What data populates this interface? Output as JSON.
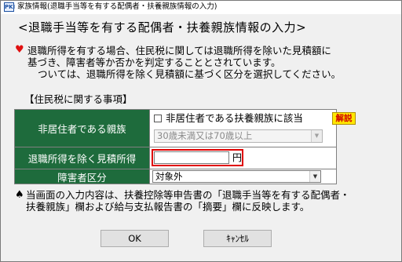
{
  "window": {
    "app_icon": "PKI",
    "title": "家族情報(退職手当等を有する配偶者・扶養親族情報の入力)"
  },
  "heading": "<退職手当等を有する配偶者・扶養親族情報の入力>",
  "description": {
    "bullet_icon": "heart-icon",
    "line1": "退職所得を有する場合、住民税に関しては退職所得を除いた見積額に",
    "line2": "基づき、障害者等か否かを判定することとされています。",
    "line3": "ついては、退職所得を除く見積額に基づく区分を選択してください。"
  },
  "section_label": "【住民税に関する事項】",
  "form": {
    "non_resident": {
      "label": "非居住者である親族",
      "checkbox_label": "非居住者である扶養親族に該当",
      "checked": false,
      "help_button": "解説",
      "age_select_value": "30歳未満又は70歳以上"
    },
    "estimate": {
      "label": "退職所得を除く見積所得",
      "value": "",
      "unit": "円"
    },
    "disability": {
      "label": "障害者区分",
      "selected": "対象外"
    }
  },
  "note": {
    "bullet_icon": "spade-icon",
    "line1": "当画面の入力内容は、扶養控除等申告書の「退職手当等を有する配偶者・",
    "line2": "扶養親族」欄および給与支払報告書の「摘要」欄に反映します。"
  },
  "buttons": {
    "ok": "OK",
    "cancel": "ｷｬﾝｾﾙ"
  },
  "colors": {
    "label_bg": "#1e6b3c",
    "highlight_border": "#e00000",
    "help_bg": "#ffe800",
    "heart": "#e01010"
  }
}
